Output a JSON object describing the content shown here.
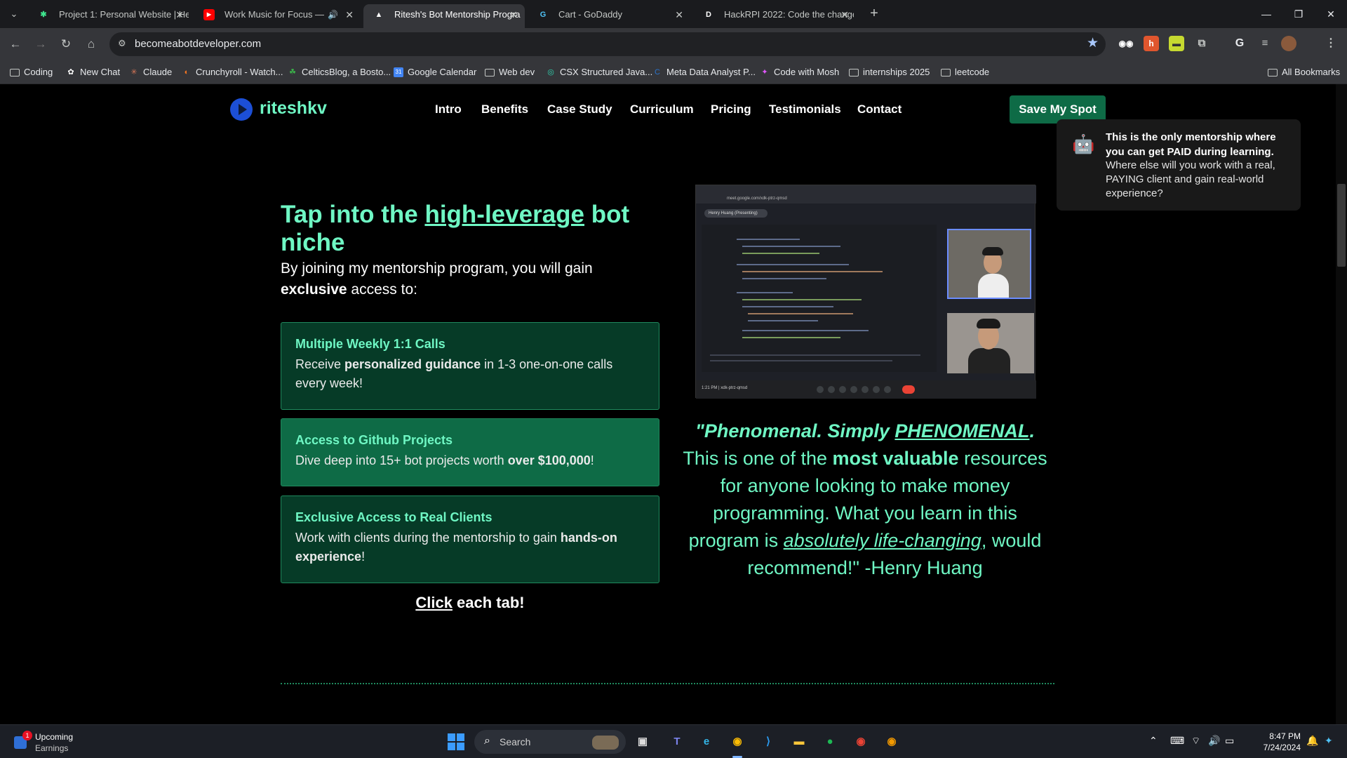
{
  "browser": {
    "tabs": [
      {
        "title": "Project 1: Personal Website | He",
        "favicon": "cursor-icon",
        "active": false
      },
      {
        "title": "Work Music for Focus — Ul",
        "favicon": "youtube-icon",
        "active": false,
        "audio": true
      },
      {
        "title": "Ritesh's Bot Mentorship Progra",
        "favicon": "triangle-icon",
        "active": true
      },
      {
        "title": "Cart - GoDaddy",
        "favicon": "godaddy-icon",
        "active": false
      },
      {
        "title": "HackRPI 2022: Code the change",
        "favicon": "devpost-icon",
        "active": false
      }
    ],
    "url": "becomeabotdeveloper.com",
    "bookmarks": [
      {
        "label": "Coding",
        "icon": "folder-icon"
      },
      {
        "label": "New Chat",
        "icon": "chatgpt-icon"
      },
      {
        "label": "Claude",
        "icon": "claude-icon"
      },
      {
        "label": "Crunchyroll - Watch...",
        "icon": "crunchyroll-icon"
      },
      {
        "label": "CelticsBlog, a Bosto...",
        "icon": "celticsblog-icon"
      },
      {
        "label": "Google Calendar",
        "icon": "calendar-icon"
      },
      {
        "label": "Web dev",
        "icon": "folder-icon"
      },
      {
        "label": "CSX Structured Java...",
        "icon": "csx-icon"
      },
      {
        "label": "Meta Data Analyst P...",
        "icon": "coursera-icon"
      },
      {
        "label": "Code with Mosh",
        "icon": "mosh-icon"
      },
      {
        "label": "internships 2025",
        "icon": "folder-icon"
      },
      {
        "label": "leetcode",
        "icon": "folder-icon"
      }
    ],
    "all_bookmarks": "All Bookmarks"
  },
  "site": {
    "brand": "riteshkv",
    "nav": [
      "Intro",
      "Benefits",
      "Case Study",
      "Curriculum",
      "Pricing",
      "Testimonials",
      "Contact"
    ],
    "cta": "Save My Spot",
    "tooltip": {
      "strong": "This is the only mentorship where you can get PAID during learning.",
      "body": "Where else will you work with a real, PAYING client and gain real-world experience?"
    },
    "headline": {
      "pre": "Tap into the ",
      "link": "high-leverage",
      "post": " bot niche"
    },
    "lead": {
      "pre": "By joining my mentorship program, you will gain ",
      "bold": "exclusive",
      "post": " access to:"
    },
    "cards": [
      {
        "title": "Multiple Weekly 1:1 Calls",
        "pre": "Receive ",
        "bold": "personalized guidance",
        "post": " in 1-3 one-on-one calls every week!"
      },
      {
        "title": "Access to Github Projects",
        "pre": "Dive deep into 15+ bot projects worth ",
        "bold": "over $100,000",
        "post": "!"
      },
      {
        "title": "Exclusive Access to Real Clients",
        "pre": "Work with clients during the mentorship to gain ",
        "bold": "hands-on experience",
        "post": "!"
      }
    ],
    "click_note": {
      "link": "Click",
      "rest": " each tab!"
    },
    "video": {
      "url": "meet.google.com/xdk-ptrz-qmsd",
      "presenting": "Henry Huang (Presenting)",
      "time": "1:21 PM | xdk-ptrz-qmsd"
    },
    "quote": {
      "italic_a": "\"Phenomenal. Simply ",
      "italic_u": "PHENOMENAL",
      "italic_b": ".",
      "t1": " This is one of the ",
      "bold": "most valuable",
      "t2": " resources for anyone looking to make money programming. What you learn in this program is ",
      "ital_link": "absolutely life-changing",
      "t3": ", would recommend!\" -Henry Huang"
    }
  },
  "taskbar": {
    "widget_title": "Upcoming",
    "widget_sub": "Earnings",
    "widget_badge": "1",
    "search": "Search",
    "apps": [
      "file-explorer-icon",
      "teams-icon",
      "edge-icon",
      "chrome-icon",
      "vscode-icon",
      "folder-icon",
      "spotify-icon",
      "chrome-icon",
      "chrome-canary-icon"
    ],
    "time": "8:47 PM",
    "date": "7/24/2024"
  }
}
